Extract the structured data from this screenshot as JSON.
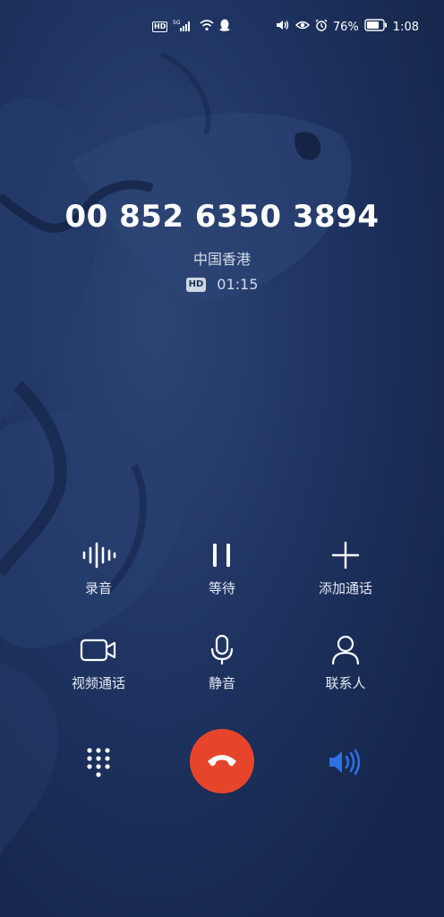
{
  "status_bar": {
    "hd_label": "HD",
    "network": "5G",
    "battery_percent": "76%",
    "time": "1:08"
  },
  "call": {
    "number": "00 852 6350 3894",
    "location": "中国香港",
    "hd_badge": "HD",
    "duration": "01:15"
  },
  "controls": [
    {
      "label": "录音",
      "icon": "waveform-icon"
    },
    {
      "label": "等待",
      "icon": "pause-icon"
    },
    {
      "label": "添加通话",
      "icon": "plus-icon"
    },
    {
      "label": "视频通话",
      "icon": "video-camera-icon"
    },
    {
      "label": "静音",
      "icon": "microphone-icon"
    },
    {
      "label": "联系人",
      "icon": "contact-icon"
    }
  ],
  "bottom_bar": {
    "dialpad": "dialpad-icon",
    "end_call": "end-call-icon",
    "speaker": "speaker-icon"
  },
  "colors": {
    "background": "#1b2f55",
    "end_call": "#e6452c",
    "speaker_active": "#2f6fe0"
  }
}
